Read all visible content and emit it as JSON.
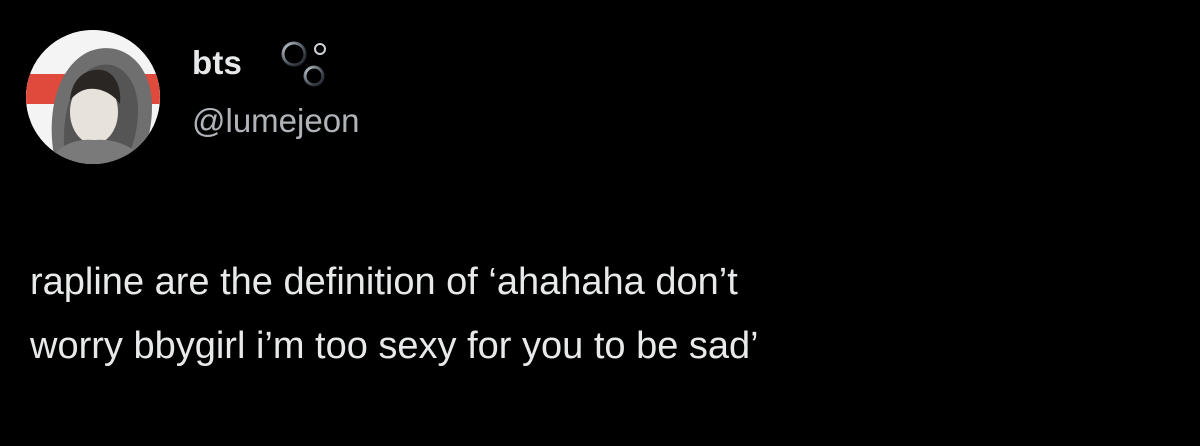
{
  "author": {
    "display_name": "bts",
    "handle": "@lumejeon",
    "name_badge_icon": "bubbles-icon",
    "avatar_colors": {
      "background": "#f4f4f4",
      "accent": "#e04a3c",
      "hood": "#6f6f6f"
    }
  },
  "tweet": {
    "lines": [
      "rapline are the definition of ‘ahahaha don’t",
      "worry bbygirl i’m too sexy for you to be sad’"
    ]
  },
  "theme": {
    "background": "#000000",
    "text": "#e7e9ea",
    "secondary_text": "#b0b4b8"
  }
}
